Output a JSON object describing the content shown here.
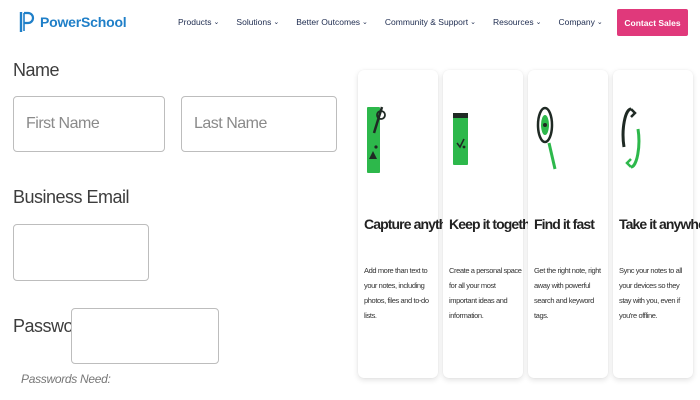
{
  "header": {
    "brand": "PowerSchool",
    "nav": [
      {
        "label": "Products"
      },
      {
        "label": "Solutions"
      },
      {
        "label": "Better Outcomes"
      },
      {
        "label": "Community & Support"
      },
      {
        "label": "Resources"
      },
      {
        "label": "Company"
      }
    ],
    "contact_label": "Contact Sales"
  },
  "form": {
    "name_label": "Name",
    "first_name_placeholder": "First Name",
    "last_name_placeholder": "Last Name",
    "email_label": "Business Email",
    "password_label": "Password",
    "password_hint": "Passwords Need:"
  },
  "cards": [
    {
      "icon": "image-note-icon",
      "title": "Capture anything",
      "description": "Add more than text to your notes, including photos, files and to-do lists."
    },
    {
      "icon": "notebook-icon",
      "title": "Keep it together",
      "description": "Create a personal space for all your most important ideas and information."
    },
    {
      "icon": "search-icon",
      "title": "Find it fast",
      "description": "Get the right note, right away with powerful search and keyword tags."
    },
    {
      "icon": "sync-icon",
      "title": "Take it anywhere",
      "description": "Sync your notes to all your devices so they stay with you, even if you're offline."
    }
  ],
  "colors": {
    "brand_blue": "#1f7fc8",
    "nav_text": "#1d2b4f",
    "contact_pink": "#e0397b",
    "icon_green": "#2db84b",
    "icon_dark": "#1f2a24"
  }
}
